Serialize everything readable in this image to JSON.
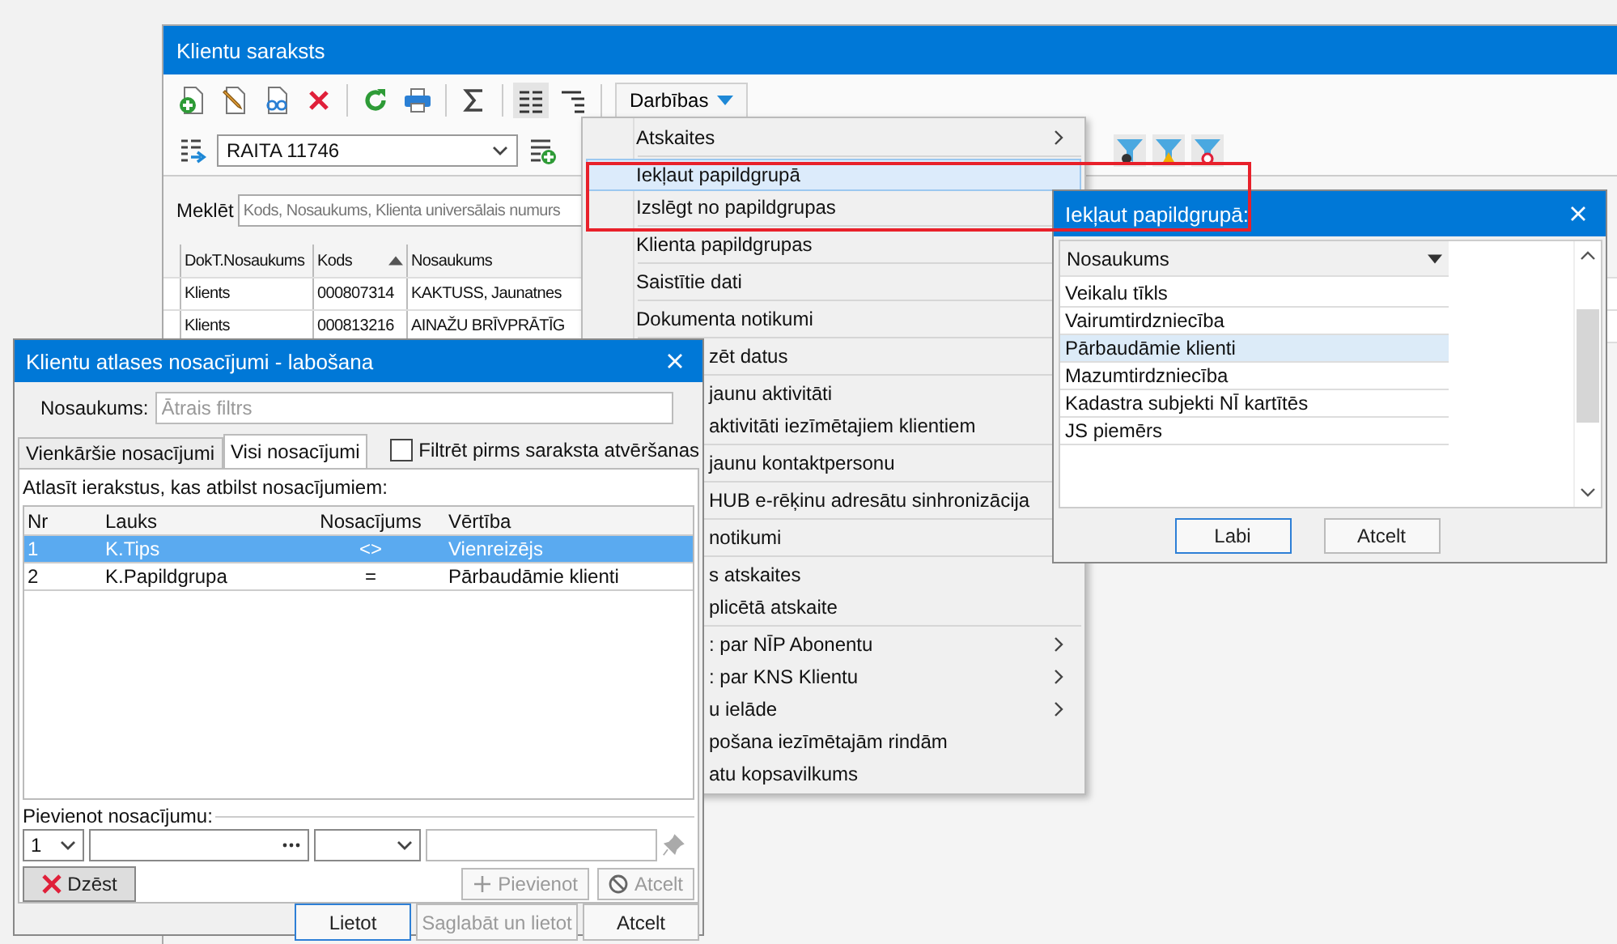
{
  "main_window": {
    "title": "Klientu saraksts",
    "actions_button": "Darbības",
    "view_combo": "RAITA 11746",
    "search": {
      "label": "Meklēt",
      "placeholder": "Kods, Nosaukums, Klienta universālais numurs"
    },
    "table": {
      "columns": [
        "DokT.Nosaukums",
        "Kods",
        "Nosaukums"
      ],
      "rows": [
        [
          "Klients",
          "000807314",
          "KAKTUSS, Jaunatnes"
        ],
        [
          "Klients",
          "000813216",
          "AINAŽU BRĪVPRĀTĪG"
        ]
      ]
    }
  },
  "actions_menu": {
    "groups": [
      {
        "items": [
          {
            "label": "Atskaites",
            "kind": "full",
            "submenu": true,
            "selected": false
          }
        ]
      },
      {
        "items": [
          {
            "label": "Iekļaut papildgrupā",
            "kind": "full",
            "submenu": false,
            "selected": true
          },
          {
            "label": "Izslēgt no papildgrupas",
            "kind": "full",
            "submenu": false,
            "selected": false
          }
        ]
      },
      {
        "items": [
          {
            "label": "Klienta papildgrupas",
            "kind": "full",
            "submenu": false,
            "selected": false
          }
        ]
      },
      {
        "items": [
          {
            "label": "Saistītie dati",
            "kind": "full",
            "submenu": false,
            "selected": false
          }
        ]
      },
      {
        "items": [
          {
            "label": "Dokumenta notikumi",
            "kind": "full",
            "submenu": false,
            "selected": false
          }
        ]
      },
      {
        "items": [
          {
            "label": "zēt datus",
            "kind": "clipped",
            "submenu": false,
            "selected": false
          }
        ]
      },
      {
        "items": [
          {
            "label": "jaunu aktivitāti",
            "kind": "clipped",
            "submenu": false,
            "selected": false
          },
          {
            "label": "aktivitāti iezīmētajiem klientiem",
            "kind": "clipped",
            "submenu": false,
            "selected": false
          }
        ]
      },
      {
        "items": [
          {
            "label": "jaunu kontaktpersonu",
            "kind": "clipped",
            "submenu": false,
            "selected": false
          }
        ]
      },
      {
        "items": [
          {
            "label": "HUB e-rēķinu adresātu sinhronizācija",
            "kind": "clipped",
            "submenu": false,
            "selected": false
          }
        ]
      },
      {
        "items": [
          {
            "label": "notikumi",
            "kind": "clipped",
            "submenu": false,
            "selected": false
          }
        ]
      },
      {
        "items": [
          {
            "label": "s atskaites",
            "kind": "clipped",
            "submenu": false,
            "selected": false
          },
          {
            "label": "plicētā atskaite",
            "kind": "clipped",
            "submenu": false,
            "selected": false
          }
        ]
      },
      {
        "items": [
          {
            "label": ": par NĪP Abonentu",
            "kind": "clipped",
            "submenu": true,
            "selected": false
          },
          {
            "label": ": par KNS Klientu",
            "kind": "clipped",
            "submenu": true,
            "selected": false
          },
          {
            "label": "u ielāde",
            "kind": "clipped",
            "submenu": true,
            "selected": false
          },
          {
            "label": "pošana iezīmētajām rindām",
            "kind": "clipped",
            "submenu": false,
            "selected": false
          },
          {
            "label": "atu kopsavilkums",
            "kind": "clipped",
            "submenu": false,
            "selected": false
          }
        ]
      }
    ]
  },
  "group_popup": {
    "title": "Iekļaut papildgrupā:",
    "column": "Nosaukums",
    "items": [
      {
        "label": "Veikalu tīkls",
        "selected": false
      },
      {
        "label": "Vairumtirdzniecība",
        "selected": false
      },
      {
        "label": "Pārbaudāmie klienti",
        "selected": true
      },
      {
        "label": "Mazumtirdzniecība",
        "selected": false
      },
      {
        "label": "Kadastra subjekti NĪ kartītēs",
        "selected": false
      },
      {
        "label": "JS piemērs",
        "selected": false
      }
    ],
    "buttons": [
      {
        "label": "Labi",
        "default": true
      },
      {
        "label": "Atcelt",
        "default": false
      }
    ]
  },
  "dialog": {
    "title": "Klientu atlases nosacījumi - labošana",
    "name_label": "Nosaukums:",
    "name_placeholder": "Ātrais filtrs",
    "tabs": [
      {
        "label": "Vienkāršie nosacījumi",
        "selected": false
      },
      {
        "label": "Visi nosacījumi",
        "selected": true
      }
    ],
    "prefilter": {
      "label": "Filtrēt pirms saraksta atvēršanas",
      "checked": false
    },
    "grid_caption": "Atlasīt ierakstus, kas atbilst nosacījumiem:",
    "grid": {
      "columns": [
        "Nr",
        "Lauks",
        "Nosacījums",
        "Vērtība"
      ],
      "rows": [
        {
          "cells": [
            "1",
            "K.Tips",
            "<>",
            "Vienreizējs"
          ],
          "selected": true
        },
        {
          "cells": [
            "2",
            "K.Papildgrupa",
            "=",
            "Pārbaudāmie klienti"
          ],
          "selected": false
        }
      ]
    },
    "add_section": {
      "label": "Pievienot nosacījumu:",
      "number": "1"
    },
    "delete_button": "Dzēst",
    "add_buttons": [
      {
        "label": "Pievienot",
        "disabled": true
      },
      {
        "label": "Atcelt",
        "disabled": true
      }
    ],
    "footer_buttons": [
      {
        "label": "Lietot",
        "disabled": false,
        "default": true
      },
      {
        "label": "Saglabāt un lietot",
        "disabled": true,
        "default": false
      },
      {
        "label": "Atcelt",
        "disabled": false,
        "default": false
      }
    ]
  }
}
